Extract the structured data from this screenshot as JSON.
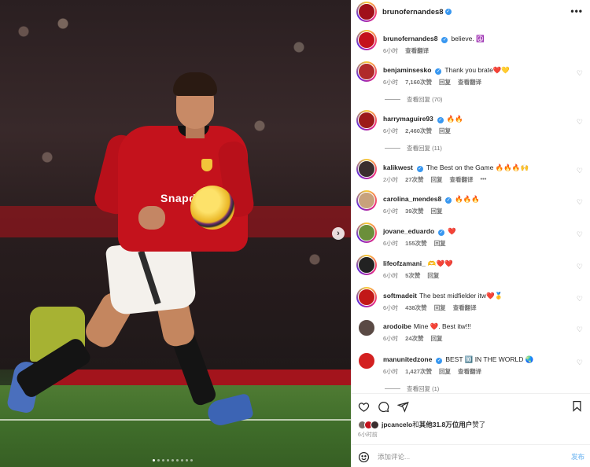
{
  "photo": {
    "sponsor_text": "Snapdragon",
    "next_icon": "chevron-right-icon",
    "dot_count": 9,
    "active_dot": 0
  },
  "header": {
    "username": "brunofernandes8",
    "more_icon": "more-horizontal-icon",
    "more_label": "•••"
  },
  "caption": {
    "username": "brunofernandes8",
    "text": "believe. ☮️",
    "time": "6小时",
    "translate": "查看翻译",
    "avatar_color": "#c4121c"
  },
  "comments": [
    {
      "username": "benjaminsesko",
      "verified": true,
      "text": "Thank you brate❤️💛",
      "time": "6小时",
      "likes": "7,160次赞",
      "reply": "回复",
      "translate": "查看翻译",
      "avatar_color": "#b02a2a",
      "ring": true
    },
    {
      "username": "harrymaguire93",
      "verified": true,
      "text": "🔥🔥",
      "time": "6小时",
      "likes": "2,460次赞",
      "reply": "回复",
      "translate": "",
      "avatar_color": "#9c1a1a",
      "ring": true
    },
    {
      "username": "kalikwest",
      "verified": true,
      "text": "The Best on the Game 🔥🔥🔥🙌",
      "time": "2小时",
      "likes": "27次赞",
      "reply": "回复",
      "translate": "查看翻译",
      "extra": "•••",
      "avatar_color": "#3a2e2e",
      "ring": true
    },
    {
      "username": "carolina_mendes8",
      "verified": true,
      "text": "🔥🔥🔥",
      "time": "6小时",
      "likes": "39次赞",
      "reply": "回复",
      "translate": "",
      "avatar_color": "#c8a27c",
      "ring": true
    },
    {
      "username": "jovane_eduardo",
      "verified": true,
      "text": "❤️",
      "time": "6小时",
      "likes": "155次赞",
      "reply": "回复",
      "translate": "",
      "avatar_color": "#6b8f3a",
      "ring": true
    },
    {
      "username": "lifeofzamani_",
      "verified": false,
      "text": "🫶❤️❤️",
      "time": "6小时",
      "likes": "5次赞",
      "reply": "回复",
      "translate": "",
      "avatar_color": "#222222",
      "ring": true
    },
    {
      "username": "softmadeit",
      "verified": false,
      "text": "The best midfielder itw❤️🥇",
      "time": "6小时",
      "likes": "438次赞",
      "reply": "回复",
      "translate": "查看翻译",
      "avatar_color": "#c21818",
      "ring": true
    },
    {
      "username": "arodoibe",
      "verified": false,
      "text": "Mine ❤️. Best itw!!!",
      "time": "6小时",
      "likes": "24次赞",
      "reply": "回复",
      "translate": "",
      "avatar_color": "#5a4a44",
      "ring": false
    },
    {
      "username": "manunitedzone",
      "verified": true,
      "text": "BEST 🔟 IN THE WORLD 🌏",
      "time": "6小时",
      "likes": "1,427次赞",
      "reply": "回复",
      "translate": "查看翻译",
      "avatar_color": "#d32020",
      "ring": false
    }
  ],
  "reply_threads": {
    "benjaminsesko": "查看回复 (70)",
    "harrymaguire93": "查看回复 (11)",
    "manunitedzone": "查看回复 (1)"
  },
  "actions": {
    "like_icon": "heart-icon",
    "comment_icon": "comment-icon",
    "share_icon": "send-icon",
    "save_icon": "bookmark-icon"
  },
  "likes": {
    "user": "jpcancelo",
    "text_mid": "和",
    "others": "其他31.8万位用户",
    "text_end": "赞了",
    "time": "6小时前"
  },
  "add_comment": {
    "placeholder": "添加评论...",
    "post_label": "发布",
    "emoji_icon": "smiley-icon"
  },
  "colors": {
    "verified": "#3897f0",
    "post_button_disabled": "#8fc6f4",
    "heart_red": "#ed4956"
  }
}
